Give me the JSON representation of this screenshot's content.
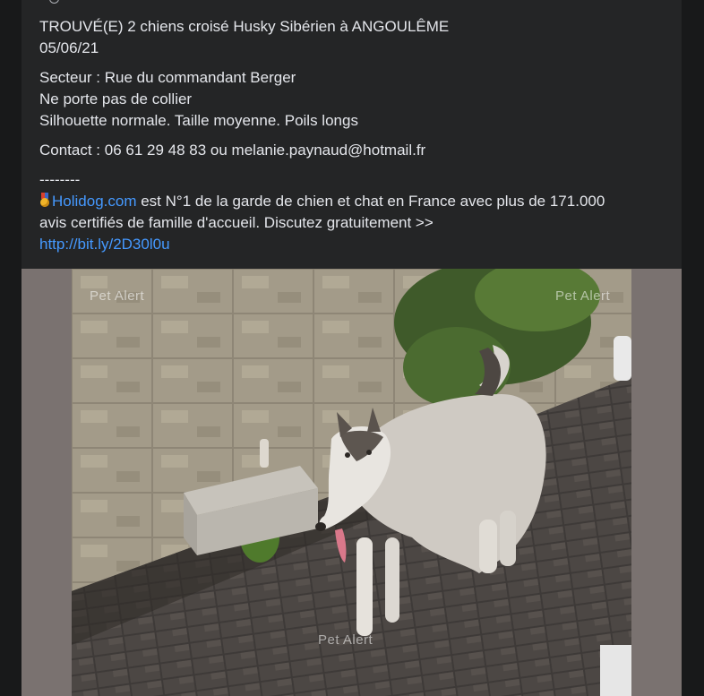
{
  "post": {
    "title_line": "TROUVÉ(E) 2 chiens croisé Husky Sibérien à ANGOULÊME",
    "date": "05/06/21",
    "secteur": "Secteur : Rue du commandant Berger",
    "collier": "Ne porte pas de collier",
    "description": "Silhouette normale. Taille moyenne. Poils longs",
    "contact": "Contact : 06 61 29 48 83 ou melanie.paynaud@hotmail.fr",
    "separator": "--------",
    "ad_link_text": "Holidog.com",
    "ad_text_1": " est N°1 de la garde de chien et chat en France avec plus de 171.000",
    "ad_text_2": "avis certifiés de famille d'accueil. Discutez gratuitement >>",
    "short_link": "http://bit.ly/2D30l0u"
  },
  "photo": {
    "watermark_top": "Pet  Alert",
    "watermark_bottom": "Pet  Alert"
  },
  "icons": {
    "medal": "medal-icon",
    "audience": "globe-icon"
  },
  "colors": {
    "background": "#18191a",
    "card": "#242526",
    "text": "#e4e6eb",
    "link": "#4599ff",
    "media_frame": "#7a7270"
  }
}
